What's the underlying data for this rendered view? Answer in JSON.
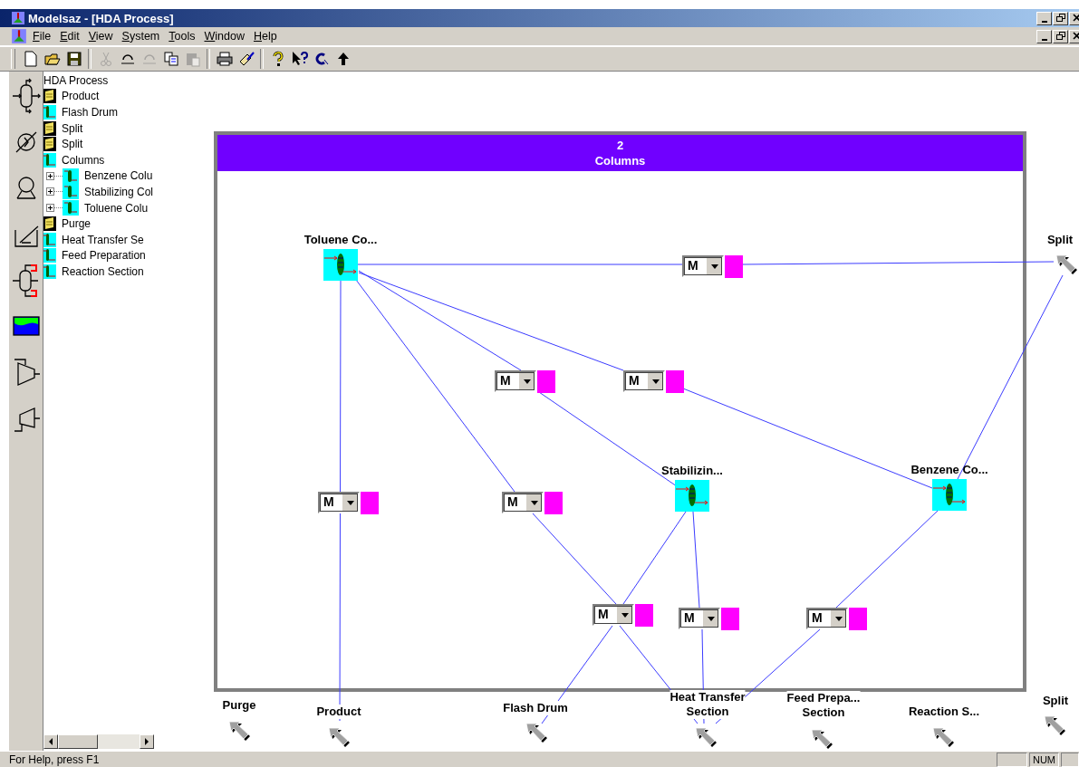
{
  "window": {
    "title": "Modelsaz - [HDA Process]"
  },
  "menu": [
    "File",
    "Edit",
    "View",
    "System",
    "Tools",
    "Window",
    "Help"
  ],
  "toolbar": [
    {
      "kind": "new",
      "disabled": false
    },
    {
      "kind": "open",
      "disabled": false
    },
    {
      "kind": "save",
      "disabled": false
    },
    {
      "kind": "separator"
    },
    {
      "kind": "cut",
      "disabled": true
    },
    {
      "kind": "undo",
      "disabled": false
    },
    {
      "kind": "redo",
      "disabled": true
    },
    {
      "kind": "copy",
      "disabled": false
    },
    {
      "kind": "paste",
      "disabled": true
    },
    {
      "kind": "separator"
    },
    {
      "kind": "print",
      "disabled": false
    },
    {
      "kind": "wizard",
      "disabled": false
    },
    {
      "kind": "separator"
    },
    {
      "kind": "help",
      "disabled": false
    },
    {
      "kind": "context-help",
      "disabled": false
    },
    {
      "kind": "connect",
      "disabled": false
    },
    {
      "kind": "up",
      "disabled": false
    }
  ],
  "palette": [
    {
      "kind": "column"
    },
    {
      "kind": "heater"
    },
    {
      "kind": "pump"
    },
    {
      "kind": "reactor"
    },
    {
      "kind": "reflux-column"
    },
    {
      "kind": "tank"
    },
    {
      "kind": "compressor"
    },
    {
      "kind": "turbine"
    }
  ],
  "tree": {
    "root": "HDA Process",
    "items": [
      {
        "label": "Product",
        "kind": "folder"
      },
      {
        "label": "Flash Drum",
        "kind": "unit"
      },
      {
        "label": "Split",
        "kind": "folder"
      },
      {
        "label": "Split",
        "kind": "folder"
      },
      {
        "label": "Columns",
        "kind": "unit",
        "children": [
          {
            "label": "Benzene Colu",
            "kind": "unit",
            "expanded": false
          },
          {
            "label": "Stabilizing Col",
            "kind": "unit",
            "expanded": false
          },
          {
            "label": "Toluene Colu",
            "kind": "unit",
            "expanded": false
          }
        ]
      },
      {
        "label": "Purge",
        "kind": "folder"
      },
      {
        "label": "Heat Transfer Se",
        "kind": "unit"
      },
      {
        "label": "Feed Preparation",
        "kind": "unit"
      },
      {
        "label": "Reaction Section",
        "kind": "unit"
      }
    ]
  },
  "subwindow": {
    "count": "2",
    "title": "Columns"
  },
  "columns": [
    {
      "label": "Toluene Co..."
    },
    {
      "label": "Stabilizin..."
    },
    {
      "label": "Benzene Co..."
    }
  ],
  "mixers": [
    {
      "value": "M"
    },
    {
      "value": "M"
    },
    {
      "value": "M"
    },
    {
      "value": "M"
    },
    {
      "value": "M"
    },
    {
      "value": "M"
    },
    {
      "value": "M"
    },
    {
      "value": "M"
    }
  ],
  "ports": [
    {
      "label": "Split"
    },
    {
      "label": "Purge"
    },
    {
      "label": "Product"
    },
    {
      "label": "Flash Drum"
    },
    {
      "label": "Heat Transfer\nSection"
    },
    {
      "label": "Feed Prepa...\nSection"
    },
    {
      "label": "Reaction S..."
    },
    {
      "label": "Split"
    }
  ],
  "status_bar": {
    "text": "For Help, press F1",
    "indicators": [
      "NUM"
    ]
  }
}
